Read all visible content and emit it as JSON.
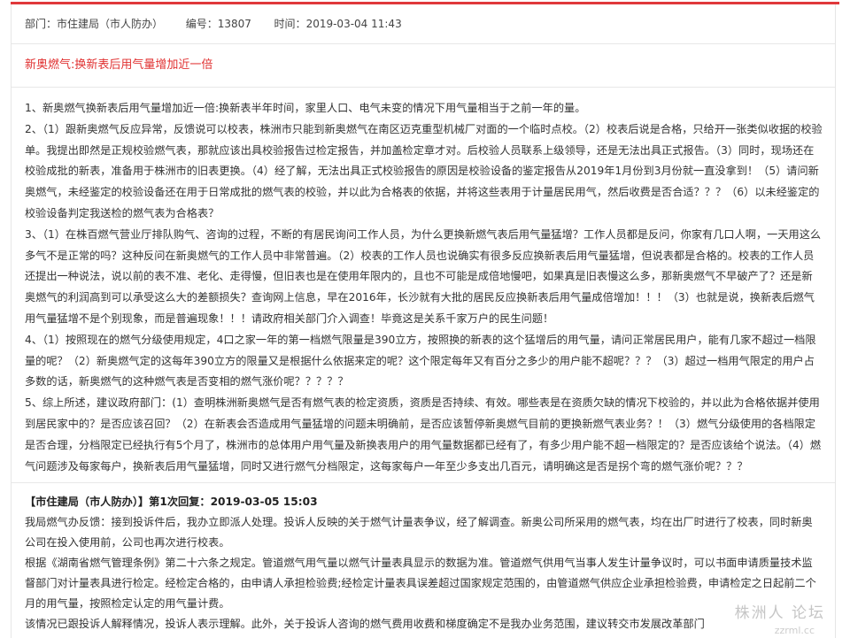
{
  "meta": {
    "department_label": "部门：",
    "department_value": "市住建局（市人防办）",
    "number_label": "编号：",
    "number_value": "13807",
    "time_label": "时间：",
    "time_value": "2019-03-04 11:43"
  },
  "post": {
    "title": "新奥燃气:换新表后用气量增加近一倍",
    "paragraphs": [
      "1、新奥燃气换新表后用气量增加近一倍:换新表半年时间，家里人口、电气未变的情况下用气量相当于之前一年的量。",
      "2、（1）跟新奥燃气反应异常，反馈说可以校表，株洲市只能到新奥燃气在南区迈克重型机械厂对面的一个临时点校。（2）校表后说是合格，只给开一张类似收据的校验单。我提出即然是正规校验燃气表，那就应该出具校验报告过检定报告，并加盖检定章才对。后校验人员联系上级领导，还是无法出具正式报告。（3）同时，现场还在校验成批的新表，准备用于株洲市的旧表更换。（4）经了解，无法出具正式校验报告的原因是校验设备的鉴定报告从2019年1月份到3月份就一直没拿到！（5）请问新奥燃气，未经鉴定的校验设备还在用于日常成批的燃气表的校验，并以此为合格表的依据，并将这些表用于计量居民用气，然后收费是否合适？？？（6）以未经鉴定的校验设备判定我送检的燃气表为合格表？",
      "3、（1）在株百燃气营业厅排队购气、咨询的过程，不断的有居民询问工作人员，为什么更换新燃气表后用气量猛增？工作人员都是反问，你家有几口人啊，一天用这么多气不是正常的吗？这种反问在新奥燃气的工作人员中非常普遍。（2）校表的工作人员也说确实有很多反应换新表后用气量猛增，但说表都是合格的。校表的工作人员还提出一种说法，说以前的表不准、老化、走得慢，但旧表也是在使用年限内的，且也不可能是成倍地慢吧，如果真是旧表慢这么多，那新奥燃气不早破产了？还是新奥燃气的利润高到可以承受这么大的差额损失？查询网上信息，早在2016年，长沙就有大批的居民反应换新表后用气量成倍增加！！！（3）也就是说，换新表后燃气用气量猛增不是个别现象，而是普遍现象！！！请政府相关部门介入调查！毕竟这是关系千家万户的民生问题！",
      "4、（1）按照现在的燃气分级使用规定，4口之家一年的第一档燃气限量是390立方，按照换的新表的这个猛增后的用气量，请问正常居民用户，能有几家不超过一档限量的呢？（2）新奥燃气定的这每年390立方的限量又是根据什么依据来定的呢？这个限定每年又有百分之多少的用户能不超呢？？？（3）超过一档用气限定的用户占多数的话，新奥燃气的这种燃气表是否变相的燃气涨价呢？？？？？",
      "5、综上所述，建议政府部门：(1）查明株洲新奥燃气是否有燃气表的检定资质，资质是否持续、有效。哪些表是在资质欠缺的情况下校验的，并以此为合格依据并使用到居民家中的？是否应该召回？（2）在新表会否造成用气量猛增的问题未明确前，是否应该暂停新奥燃气目前的更换新燃气表业务？！（3）燃气分级使用的各档限定是否合理，分档限定已经执行有5个月了，株洲市的总体用户用气量及新换表用户的用气量数据都已经有了，有多少用户能不超一档限定的？是否应该给个说法。（4）燃气问题涉及每家每户，换新表后用气量猛增，同时又进行燃气分档限定，这每家每户一年至少多支出几百元，请明确这是否是拐个弯的燃气涨价呢？？？"
    ]
  },
  "reply": {
    "header": "【市住建局（市人防办）】第1次回复：2019-03-05 15:03",
    "paragraphs": [
      "我局燃气办反馈：接到投诉件后，我办立即派人处理。投诉人反映的关于燃气计量表争议，经了解调查。新奥公司所采用的燃气表，均在出厂时进行了校表，同时新奥公司在投入使用前，公司也再次进行校表。",
      "根据《湖南省燃气管理条例》第二十六条之规定。管道燃气用气量以燃气计量表具显示的数据为准。管道燃气供用气当事人发生计量争议时，可以书面申请质量技术监督部门对计量表具进行检定。经检定合格的，由申请人承担检验费;经检定计量表具误差超过国家规定范围的，由管道燃气供应企业承担检验费，申请检定之日起前二个月的用气量，按照检定认定的用气量计费。",
      "该情况已跟投诉人解释情况，投诉人表示理解。此外，关于投诉人咨询的燃气费用收费和梯度确定不是我办业务范围，建议转交市发展改革部门"
    ]
  },
  "watermark": {
    "text": "株洲人 论坛",
    "sub": "zzrml.cc"
  }
}
